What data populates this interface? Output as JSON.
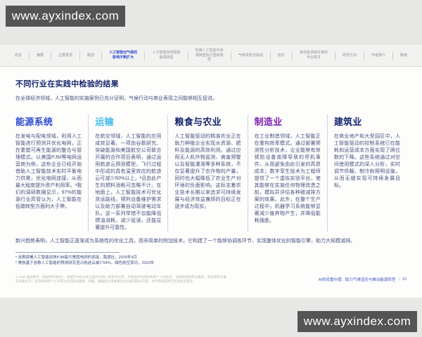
{
  "watermark": {
    "text": "www.ayxindex.com"
  },
  "nav": {
    "items": [
      {
        "label": "前言"
      },
      {
        "label": "摘要"
      },
      {
        "label": "主要发现"
      },
      {
        "label": "概述"
      },
      {
        "label": "人工智能对气候的影响不断扩大"
      },
      {
        "label": "人工智能如何赋能能源转型"
      },
      {
        "label": "利用人工智能与资源转型执行国家意愿"
      },
      {
        "label": "气候风险与挑战"
      },
      {
        "label": "结论"
      },
      {
        "label": "来自各领域专家的专业意见"
      },
      {
        "label": "研究方法"
      },
      {
        "label": "作者简介"
      },
      {
        "label": "致谢"
      }
    ]
  },
  "page": {
    "title": "不同行业在实践中检验的结果",
    "subtitle": "在全球经济领域，人工智能的实施案例已充分证明，气候行动与商业表现之间能够相互促进。",
    "columns": [
      {
        "title": "能源系统",
        "color": "#2b49d0",
        "body": "在发电与配电领域，利用人工智能进行预测并优化电网，正在重塑可再生能源的整合与管理模式。以美国PJM等电网运营商为例，这些企业已经开始借助人工智能技术实时平衡电力供需，优化电网连接，从而最大程度提升资产利用率。ᵃ我们的调研数据显示，97%的能源行业高管认为，人工智能在低碳转型方面利大于弊。"
      },
      {
        "title": "运输",
        "color": "#41b9ea",
        "body": "在航空领域，人工智能的应用成效显著。一项由谷歌研究、突破能源和美国航空公司联合开展的合作项目表明，通过运用航迹云预测模型，飞行过程中形成的具有温室效应的航迹云可减少50%以上，ᵇ且由此产生的燃料消耗可忽略不计。在地面上，人工智能技术可优化货运路线，预判设备维护需求以及助力部署自动驾驶电动车队。这一系列举措不仅能降低燃油消耗，减少延误，还能显著提升可靠性。"
      },
      {
        "title": "粮食与农业",
        "color": "#16266d",
        "body": "人工智能驱动的精准农业正在助力种植企业实现水资源、肥料及能源的高效利用。通过应用无人机作物监测、病害预警以及智能灌溉等多种系统，不仅显著提升了农作物的产量，同时也大幅降低了农业生产对环境的负面影响。这标志着农业技术长期以来追求可持续发展与经济效益兼顾的目标正在逐步成为现实。"
      },
      {
        "title": "制造业",
        "color": "#8021b0",
        "body": "在工业制造领域，人工智能正在重构效率模式。通过部署预测性分析技术，企业能够有效预防设备故障导致的停机事件，从而避免由此引发的高昂成本；数字孪生技术为工程师提供了一个虚拟实验平台，使其能够在实施任何物理改造之前，模拟并评估各种碳减排方案的效果。此外，在整个生产过程中，机器学习系统能够显著减少废弃物产生，并降低能耗强度。"
      },
      {
        "title": "建筑业",
        "color": "#16266d",
        "body": "在商业地产和大型园区中，人工智能驱动的控制系统已在能耗和运营成本方面实现了两位数的下降。这些系统通过对空间使用模式的深入分析，实时调节供暖、制冷和照明设施，从而无缝实现可持续发展目标。"
      }
    ],
    "conclusion": "新兴趋势表明，人工智能正逐渐成为系统性的优化工具，而非简单的附加技术。它构建了一个能够协调各环节、实现整体优化的智能引擎，助力大规模减排。",
    "footnotes": [
      "ᵃ 谷歌部署人工智能加快PJM最大美国电网的连接，路透社，2025年4月",
      "ᵇ 美航基于谷歌人工智能的预测研究显示航迹云减少54%，绿色航空资讯，2023年"
    ],
    "disclaimer": "© 2025 版权所有（保留所有权利）。本报告中的分析与观点仅供一般参考之用，不构成对任何机构或个人的投资、法律或其他专业建议。未经发布方事先书面许可，任何机构或个人不得以任何形式复制、转载、摘编或引用本报告的全部或部分内容，亦不得将其用于任何商业用途。",
    "footer": {
      "title": "AI的双重价值：助力气候适应与推动能源转型",
      "separator": "|",
      "page_number": "10"
    }
  }
}
